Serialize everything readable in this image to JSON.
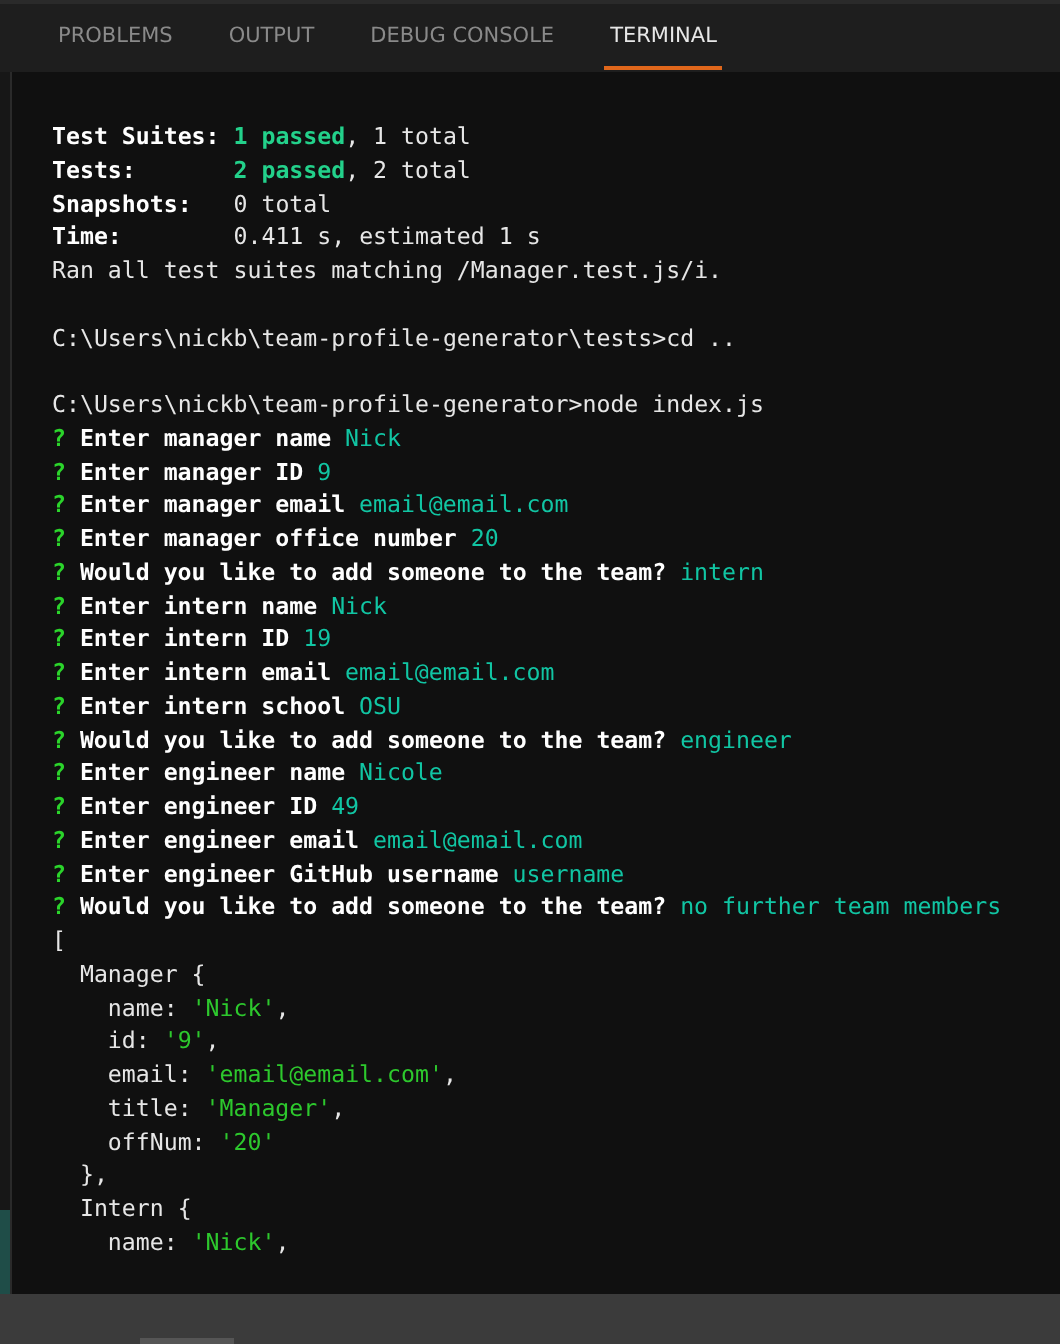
{
  "tabs": [
    {
      "label": "PROBLEMS",
      "selected": false
    },
    {
      "label": "OUTPUT",
      "selected": false
    },
    {
      "label": "DEBUG CONSOLE",
      "selected": false
    },
    {
      "label": "TERMINAL",
      "selected": true
    }
  ],
  "terminal": {
    "blocks": [
      {
        "lines": [
          [
            {
              "kind": "label",
              "text": "Test Suites: "
            },
            {
              "kind": "pass",
              "text": "1 passed"
            },
            {
              "kind": "plain",
              "text": ", 1 total"
            }
          ],
          [
            {
              "kind": "label",
              "text": "Tests:       "
            },
            {
              "kind": "pass",
              "text": "2 passed"
            },
            {
              "kind": "plain",
              "text": ", 2 total"
            }
          ],
          [
            {
              "kind": "label",
              "text": "Snapshots:   "
            },
            {
              "kind": "plain",
              "text": "0 total"
            }
          ],
          [
            {
              "kind": "label",
              "text": "Time:        "
            },
            {
              "kind": "plain",
              "text": "0.411 s, estimated 1 s"
            }
          ],
          [
            {
              "kind": "plain",
              "text": "Ran all test suites matching /Manager.test.js/i."
            }
          ]
        ]
      },
      {
        "lines": [
          [
            {
              "kind": "plain",
              "text": "C:\\Users\\nickb\\team-profile-generator\\tests>cd .."
            }
          ]
        ]
      },
      {
        "lines": [
          [
            {
              "kind": "plain",
              "text": "C:\\Users\\nickb\\team-profile-generator>node index.js"
            }
          ],
          [
            {
              "kind": "prompt",
              "text": "?"
            },
            {
              "kind": "question",
              "text": "Enter manager name"
            },
            {
              "kind": "answer",
              "text": "Nick"
            }
          ],
          [
            {
              "kind": "prompt",
              "text": "?"
            },
            {
              "kind": "question",
              "text": "Enter manager ID"
            },
            {
              "kind": "answer",
              "text": "9"
            }
          ],
          [
            {
              "kind": "prompt",
              "text": "?"
            },
            {
              "kind": "question",
              "text": "Enter manager email"
            },
            {
              "kind": "answer",
              "text": "email@email.com"
            }
          ],
          [
            {
              "kind": "prompt",
              "text": "?"
            },
            {
              "kind": "question",
              "text": "Enter manager office number"
            },
            {
              "kind": "answer",
              "text": "20"
            }
          ],
          [
            {
              "kind": "prompt",
              "text": "?"
            },
            {
              "kind": "question",
              "text": "Would you like to add someone to the team?"
            },
            {
              "kind": "answer",
              "text": "intern"
            }
          ],
          [
            {
              "kind": "prompt",
              "text": "?"
            },
            {
              "kind": "question",
              "text": "Enter intern name"
            },
            {
              "kind": "answer",
              "text": "Nick"
            }
          ],
          [
            {
              "kind": "prompt",
              "text": "?"
            },
            {
              "kind": "question",
              "text": "Enter intern ID"
            },
            {
              "kind": "answer",
              "text": "19"
            }
          ],
          [
            {
              "kind": "prompt",
              "text": "?"
            },
            {
              "kind": "question",
              "text": "Enter intern email"
            },
            {
              "kind": "answer",
              "text": "email@email.com"
            }
          ],
          [
            {
              "kind": "prompt",
              "text": "?"
            },
            {
              "kind": "question",
              "text": "Enter intern school"
            },
            {
              "kind": "answer",
              "text": "OSU"
            }
          ],
          [
            {
              "kind": "prompt",
              "text": "?"
            },
            {
              "kind": "question",
              "text": "Would you like to add someone to the team?"
            },
            {
              "kind": "answer",
              "text": "engineer"
            }
          ],
          [
            {
              "kind": "prompt",
              "text": "?"
            },
            {
              "kind": "question",
              "text": "Enter engineer name"
            },
            {
              "kind": "answer",
              "text": "Nicole"
            }
          ],
          [
            {
              "kind": "prompt",
              "text": "?"
            },
            {
              "kind": "question",
              "text": "Enter engineer ID"
            },
            {
              "kind": "answer",
              "text": "49"
            }
          ],
          [
            {
              "kind": "prompt",
              "text": "?"
            },
            {
              "kind": "question",
              "text": "Enter engineer email"
            },
            {
              "kind": "answer",
              "text": "email@email.com"
            }
          ],
          [
            {
              "kind": "prompt",
              "text": "?"
            },
            {
              "kind": "question",
              "text": "Enter engineer GitHub username"
            },
            {
              "kind": "answer",
              "text": "username"
            }
          ],
          [
            {
              "kind": "prompt",
              "text": "?"
            },
            {
              "kind": "question",
              "text": "Would you like to add someone to the team?"
            },
            {
              "kind": "answer",
              "text": "no further team members"
            }
          ],
          [
            {
              "kind": "plain",
              "text": "["
            }
          ],
          [
            {
              "kind": "plain",
              "text": "  Manager {"
            }
          ],
          [
            {
              "kind": "plain",
              "text": "    name: "
            },
            {
              "kind": "string",
              "text": "'Nick'"
            },
            {
              "kind": "plain",
              "text": ","
            }
          ],
          [
            {
              "kind": "plain",
              "text": "    id: "
            },
            {
              "kind": "string",
              "text": "'9'"
            },
            {
              "kind": "plain",
              "text": ","
            }
          ],
          [
            {
              "kind": "plain",
              "text": "    email: "
            },
            {
              "kind": "string",
              "text": "'email@email.com'"
            },
            {
              "kind": "plain",
              "text": ","
            }
          ],
          [
            {
              "kind": "plain",
              "text": "    title: "
            },
            {
              "kind": "string",
              "text": "'Manager'"
            },
            {
              "kind": "plain",
              "text": ","
            }
          ],
          [
            {
              "kind": "plain",
              "text": "    offNum: "
            },
            {
              "kind": "string",
              "text": "'20'"
            }
          ],
          [
            {
              "kind": "plain",
              "text": "  },"
            }
          ],
          [
            {
              "kind": "plain",
              "text": "  Intern {"
            }
          ],
          [
            {
              "kind": "plain",
              "text": "    name: "
            },
            {
              "kind": "string",
              "text": "'Nick'"
            },
            {
              "kind": "plain",
              "text": ","
            }
          ]
        ]
      }
    ]
  }
}
